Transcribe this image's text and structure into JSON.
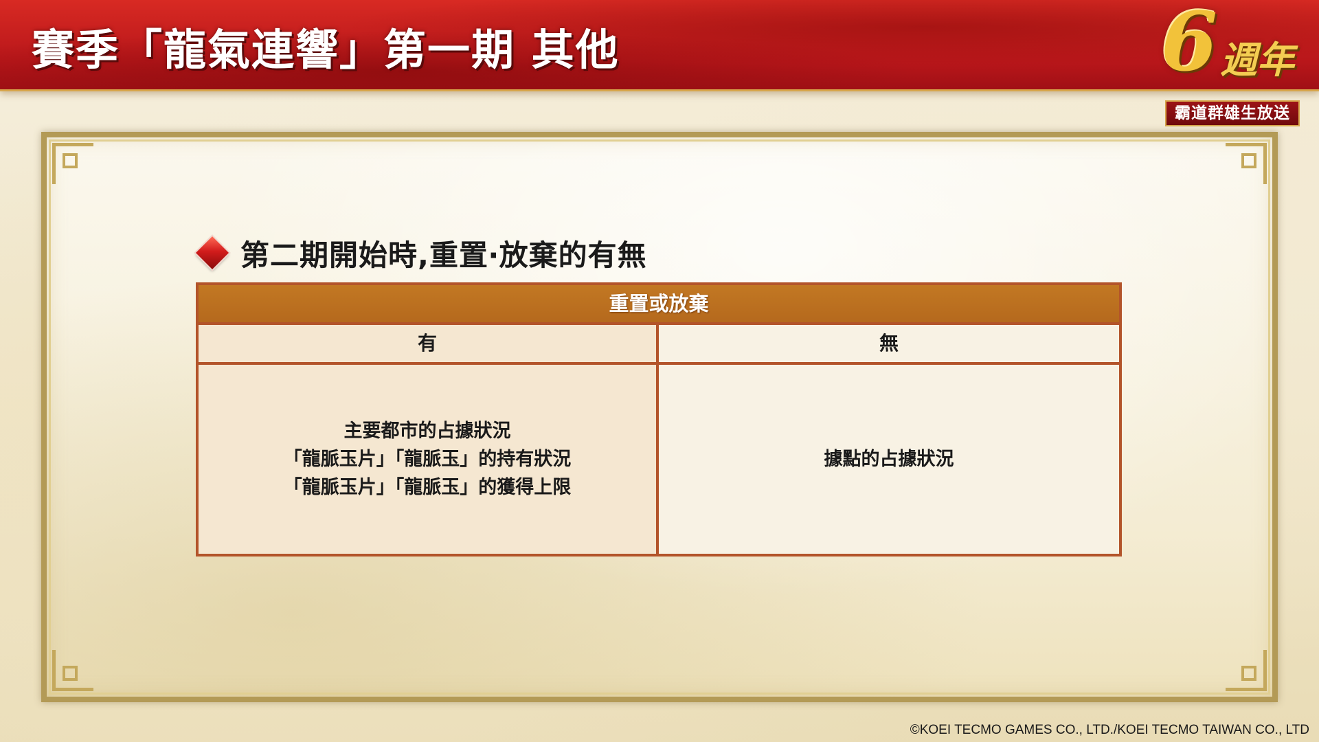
{
  "header": {
    "title": "賽季「龍氣連響」第一期 其他"
  },
  "logo": {
    "number": "6",
    "years": "週年",
    "subtitle": "霸道群雄生放送"
  },
  "section": {
    "icon": "red-diamond-icon",
    "title": "第二期開始時,重置‧放棄的有無"
  },
  "table": {
    "header": "重置或放棄",
    "columns": [
      {
        "label": "有",
        "lines": [
          "主要都市的占據狀況",
          "「龍脈玉片」「龍脈玉」的持有狀況",
          "「龍脈玉片」「龍脈玉」的獲得上限"
        ]
      },
      {
        "label": "無",
        "lines": [
          "據點的占據狀況"
        ]
      }
    ]
  },
  "footer": {
    "copyright": "©KOEI TECMO GAMES CO., LTD./KOEI TECMO TAIWAN CO., LTD"
  },
  "colors": {
    "banner_red": "#c01d1d",
    "table_header": "#bd7220",
    "table_border": "#b3542a",
    "frame_gold": "#b39a56"
  }
}
